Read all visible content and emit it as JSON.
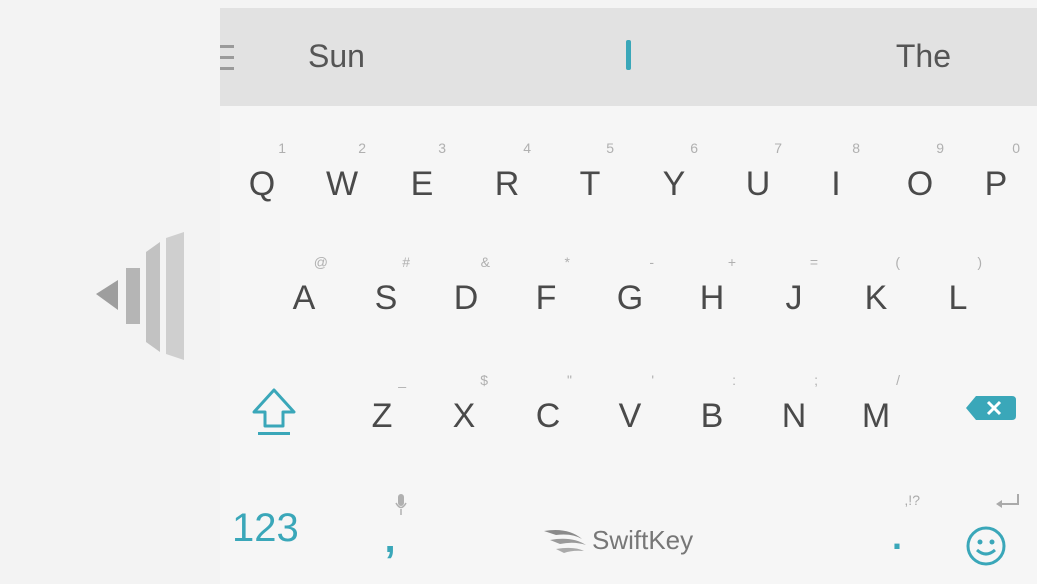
{
  "predictions": {
    "left": "Sun",
    "right": "The"
  },
  "rows": {
    "row1": [
      {
        "main": "Q",
        "hint": "1"
      },
      {
        "main": "W",
        "hint": "2"
      },
      {
        "main": "E",
        "hint": "3"
      },
      {
        "main": "R",
        "hint": "4"
      },
      {
        "main": "T",
        "hint": "5"
      },
      {
        "main": "Y",
        "hint": "6"
      },
      {
        "main": "U",
        "hint": "7"
      },
      {
        "main": "I",
        "hint": "8"
      },
      {
        "main": "O",
        "hint": "9"
      },
      {
        "main": "P",
        "hint": "0"
      }
    ],
    "row2": [
      {
        "main": "A",
        "hint": "@"
      },
      {
        "main": "S",
        "hint": "#"
      },
      {
        "main": "D",
        "hint": "&"
      },
      {
        "main": "F",
        "hint": "*"
      },
      {
        "main": "G",
        "hint": "-"
      },
      {
        "main": "H",
        "hint": "+"
      },
      {
        "main": "J",
        "hint": "="
      },
      {
        "main": "K",
        "hint": "("
      },
      {
        "main": "L",
        "hint": ")"
      }
    ],
    "row3": [
      {
        "main": "Z",
        "hint": "_"
      },
      {
        "main": "X",
        "hint": "$"
      },
      {
        "main": "C",
        "hint": "\""
      },
      {
        "main": "V",
        "hint": "'"
      },
      {
        "main": "B",
        "hint": ":"
      },
      {
        "main": "N",
        "hint": ";"
      },
      {
        "main": "M",
        "hint": "/"
      }
    ]
  },
  "bottom": {
    "num_label": "123",
    "comma": ",",
    "brand": "SwiftKey",
    "period": ".",
    "period_hint": ",!?"
  },
  "icons": {
    "menu": "menu-icon",
    "resize": "resize-arrow-icon",
    "shift": "shift-icon",
    "backspace": "backspace-icon",
    "mic": "mic-icon",
    "logo": "swiftkey-logo-icon",
    "enter": "enter-icon",
    "emoji": "emoji-icon"
  },
  "colors": {
    "accent": "#3aa7b9",
    "key_text": "#4a4a4a",
    "prediction_bar": "#e2e2e2"
  }
}
